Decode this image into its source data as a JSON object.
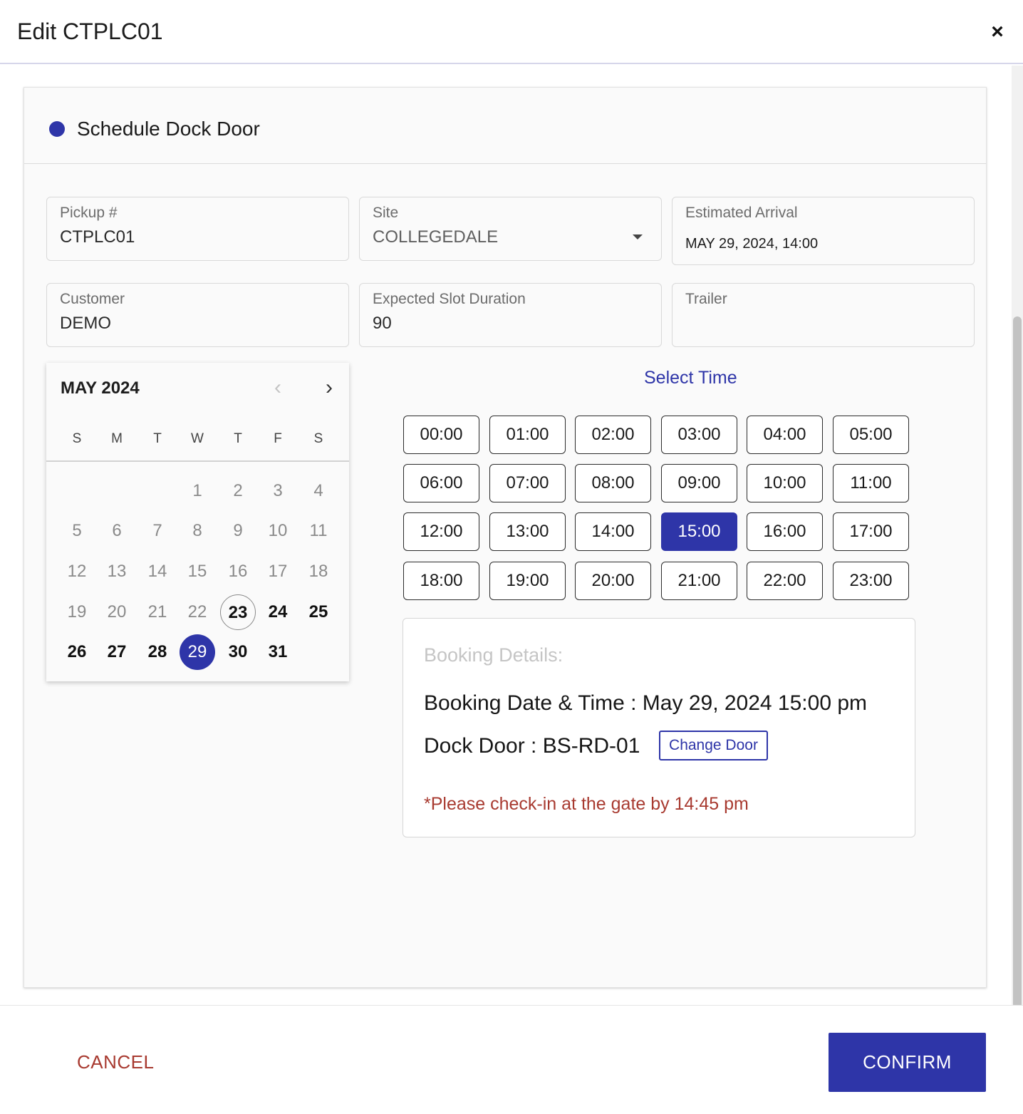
{
  "header": {
    "title": "Edit CTPLC01",
    "close_icon": "×"
  },
  "section": {
    "title": "Schedule Dock Door",
    "accent": "#2e35a8"
  },
  "fields": {
    "pickup": {
      "label": "Pickup #",
      "value": "CTPLC01"
    },
    "site": {
      "label": "Site",
      "value": "COLLEGEDALE"
    },
    "estimated_arrival": {
      "label": "Estimated Arrival",
      "value": "MAY 29, 2024, 14:00"
    },
    "customer": {
      "label": "Customer",
      "value": "DEMO"
    },
    "slot_duration": {
      "label": "Expected Slot Duration",
      "value": "90"
    },
    "trailer": {
      "label": "Trailer",
      "value": ""
    }
  },
  "calendar": {
    "month_label": "MAY 2024",
    "prev_icon": "‹",
    "next_icon": "›",
    "weekdays": [
      "S",
      "M",
      "T",
      "W",
      "T",
      "F",
      "S"
    ],
    "first_weekday_index": 3,
    "days_in_month": 31,
    "today": 23,
    "selected": 29
  },
  "time": {
    "heading": "Select Time",
    "slots": [
      "00:00",
      "01:00",
      "02:00",
      "03:00",
      "04:00",
      "05:00",
      "06:00",
      "07:00",
      "08:00",
      "09:00",
      "10:00",
      "11:00",
      "12:00",
      "13:00",
      "14:00",
      "15:00",
      "16:00",
      "17:00",
      "18:00",
      "19:00",
      "20:00",
      "21:00",
      "22:00",
      "23:00"
    ],
    "selected": "15:00"
  },
  "booking": {
    "heading": "Booking Details:",
    "date_time": "Booking Date & Time : May 29, 2024 15:00 pm",
    "dock_door": "Dock Door : BS-RD-01",
    "change_door_label": "Change Door",
    "checkin_note": "*Please check-in at the gate by 14:45 pm"
  },
  "footer": {
    "cancel_label": "CANCEL",
    "confirm_label": "CONFIRM"
  }
}
